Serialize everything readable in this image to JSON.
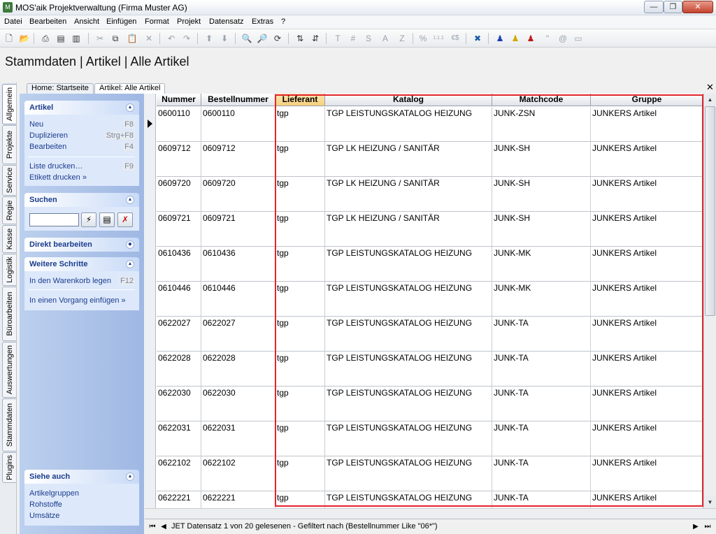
{
  "window": {
    "title": "MOS'aik Projektverwaltung (Firma Muster AG)"
  },
  "menu": [
    "Datei",
    "Bearbeiten",
    "Ansicht",
    "Einfügen",
    "Format",
    "Projekt",
    "Datensatz",
    "Extras",
    "?"
  ],
  "toolbar": {
    "text_buttons": [
      "T",
      "#",
      "S",
      "A",
      "Z",
      "%",
      "1.1.1",
      "€$"
    ]
  },
  "heading": "Stammdaten | Artikel | Alle Artikel",
  "vertical_tabs": [
    "Allgemein",
    "Projekte",
    "Service",
    "Regie",
    "Kasse",
    "Logistik",
    "Büroarbeiten",
    "Auswertungen",
    "Stammdaten",
    "Plugins"
  ],
  "doc_tabs": [
    "Home: Startseite",
    "Artikel: Alle Artikel"
  ],
  "taskpane": {
    "artikel": {
      "title": "Artikel",
      "items": [
        {
          "label": "Neu",
          "key": "F8"
        },
        {
          "label": "Duplizieren",
          "key": "Strg+F8"
        },
        {
          "label": "Bearbeiten",
          "key": "F4"
        },
        {
          "label": "Liste drucken…",
          "key": "F9"
        },
        {
          "label": "Etikett drucken »",
          "key": ""
        }
      ]
    },
    "suchen": {
      "title": "Suchen",
      "value": ""
    },
    "direkt": {
      "title": "Direkt bearbeiten"
    },
    "weitere": {
      "title": "Weitere Schritte",
      "items": [
        {
          "label": "In den Warenkorb legen",
          "key": "F12"
        },
        {
          "label": "In einen Vorgang einfügen »",
          "key": ""
        }
      ]
    },
    "siehe": {
      "title": "Siehe auch",
      "items": [
        "Artikelgruppen",
        "Rohstoffe",
        "Umsätze"
      ]
    }
  },
  "grid": {
    "columns": [
      "Nummer",
      "Bestellnummer",
      "Lieferant",
      "Katalog",
      "Matchcode",
      "Gruppe"
    ],
    "rows": [
      [
        "0600110",
        "0600110",
        "tgp",
        "TGP LEISTUNGSKATALOG  HEIZUNG",
        "JUNK-ZSN",
        "JUNKERS Artikel"
      ],
      [
        "0609712",
        "0609712",
        "tgp",
        "TGP LK  HEIZUNG / SANITÄR",
        "JUNK-SH",
        "JUNKERS Artikel"
      ],
      [
        "0609720",
        "0609720",
        "tgp",
        "TGP LK  HEIZUNG / SANITÄR",
        "JUNK-SH",
        "JUNKERS Artikel"
      ],
      [
        "0609721",
        "0609721",
        "tgp",
        "TGP LK  HEIZUNG / SANITÄR",
        "JUNK-SH",
        "JUNKERS Artikel"
      ],
      [
        "0610436",
        "0610436",
        "tgp",
        "TGP LEISTUNGSKATALOG  HEIZUNG",
        "JUNK-MK",
        "JUNKERS Artikel"
      ],
      [
        "0610446",
        "0610446",
        "tgp",
        "TGP LEISTUNGSKATALOG  HEIZUNG",
        "JUNK-MK",
        "JUNKERS Artikel"
      ],
      [
        "0622027",
        "0622027",
        "tgp",
        "TGP LEISTUNGSKATALOG  HEIZUNG",
        "JUNK-TA",
        "JUNKERS Artikel"
      ],
      [
        "0622028",
        "0622028",
        "tgp",
        "TGP LEISTUNGSKATALOG  HEIZUNG",
        "JUNK-TA",
        "JUNKERS Artikel"
      ],
      [
        "0622030",
        "0622030",
        "tgp",
        "TGP LEISTUNGSKATALOG  HEIZUNG",
        "JUNK-TA",
        "JUNKERS Artikel"
      ],
      [
        "0622031",
        "0622031",
        "tgp",
        "TGP LEISTUNGSKATALOG  HEIZUNG",
        "JUNK-TA",
        "JUNKERS Artikel"
      ],
      [
        "0622102",
        "0622102",
        "tgp",
        "TGP LEISTUNGSKATALOG  HEIZUNG",
        "JUNK-TA",
        "JUNKERS Artikel"
      ],
      [
        "0622221",
        "0622221",
        "tgp",
        "TGP LEISTUNGSKATALOG  HEIZUNG",
        "JUNK-TA",
        "JUNKERS Artikel"
      ]
    ]
  },
  "status": "JET Datensatz 1 von 20 gelesenen - Gefiltert nach (Bestellnummer Like \"06*\")",
  "colors": {
    "highlight": "#e3252c",
    "selected_header": "#f6cf7a",
    "link": "#1b3d8c"
  }
}
